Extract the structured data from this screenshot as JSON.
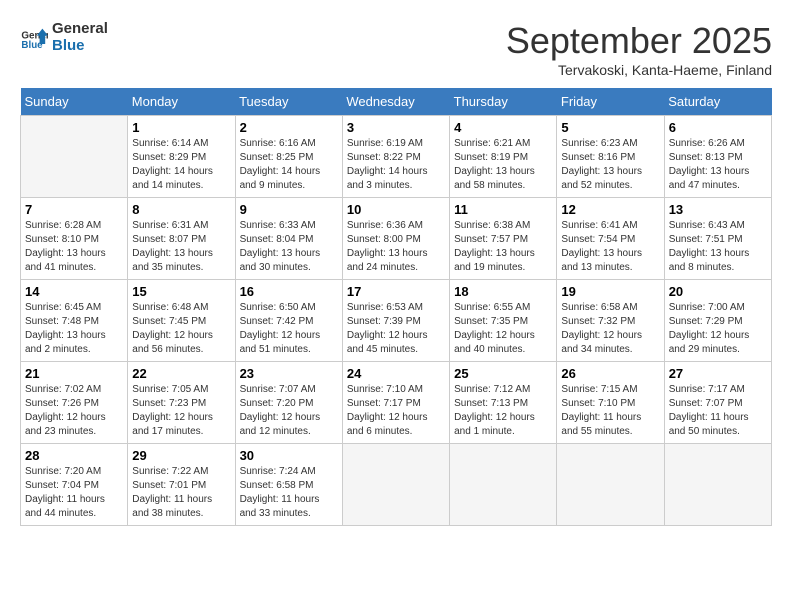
{
  "logo": {
    "line1": "General",
    "line2": "Blue"
  },
  "title": "September 2025",
  "location": "Tervakoski, Kanta-Haeme, Finland",
  "days_of_week": [
    "Sunday",
    "Monday",
    "Tuesday",
    "Wednesday",
    "Thursday",
    "Friday",
    "Saturday"
  ],
  "weeks": [
    [
      {
        "day": "",
        "info": ""
      },
      {
        "day": "1",
        "info": "Sunrise: 6:14 AM\nSunset: 8:29 PM\nDaylight: 14 hours\nand 14 minutes."
      },
      {
        "day": "2",
        "info": "Sunrise: 6:16 AM\nSunset: 8:25 PM\nDaylight: 14 hours\nand 9 minutes."
      },
      {
        "day": "3",
        "info": "Sunrise: 6:19 AM\nSunset: 8:22 PM\nDaylight: 14 hours\nand 3 minutes."
      },
      {
        "day": "4",
        "info": "Sunrise: 6:21 AM\nSunset: 8:19 PM\nDaylight: 13 hours\nand 58 minutes."
      },
      {
        "day": "5",
        "info": "Sunrise: 6:23 AM\nSunset: 8:16 PM\nDaylight: 13 hours\nand 52 minutes."
      },
      {
        "day": "6",
        "info": "Sunrise: 6:26 AM\nSunset: 8:13 PM\nDaylight: 13 hours\nand 47 minutes."
      }
    ],
    [
      {
        "day": "7",
        "info": "Sunrise: 6:28 AM\nSunset: 8:10 PM\nDaylight: 13 hours\nand 41 minutes."
      },
      {
        "day": "8",
        "info": "Sunrise: 6:31 AM\nSunset: 8:07 PM\nDaylight: 13 hours\nand 35 minutes."
      },
      {
        "day": "9",
        "info": "Sunrise: 6:33 AM\nSunset: 8:04 PM\nDaylight: 13 hours\nand 30 minutes."
      },
      {
        "day": "10",
        "info": "Sunrise: 6:36 AM\nSunset: 8:00 PM\nDaylight: 13 hours\nand 24 minutes."
      },
      {
        "day": "11",
        "info": "Sunrise: 6:38 AM\nSunset: 7:57 PM\nDaylight: 13 hours\nand 19 minutes."
      },
      {
        "day": "12",
        "info": "Sunrise: 6:41 AM\nSunset: 7:54 PM\nDaylight: 13 hours\nand 13 minutes."
      },
      {
        "day": "13",
        "info": "Sunrise: 6:43 AM\nSunset: 7:51 PM\nDaylight: 13 hours\nand 8 minutes."
      }
    ],
    [
      {
        "day": "14",
        "info": "Sunrise: 6:45 AM\nSunset: 7:48 PM\nDaylight: 13 hours\nand 2 minutes."
      },
      {
        "day": "15",
        "info": "Sunrise: 6:48 AM\nSunset: 7:45 PM\nDaylight: 12 hours\nand 56 minutes."
      },
      {
        "day": "16",
        "info": "Sunrise: 6:50 AM\nSunset: 7:42 PM\nDaylight: 12 hours\nand 51 minutes."
      },
      {
        "day": "17",
        "info": "Sunrise: 6:53 AM\nSunset: 7:39 PM\nDaylight: 12 hours\nand 45 minutes."
      },
      {
        "day": "18",
        "info": "Sunrise: 6:55 AM\nSunset: 7:35 PM\nDaylight: 12 hours\nand 40 minutes."
      },
      {
        "day": "19",
        "info": "Sunrise: 6:58 AM\nSunset: 7:32 PM\nDaylight: 12 hours\nand 34 minutes."
      },
      {
        "day": "20",
        "info": "Sunrise: 7:00 AM\nSunset: 7:29 PM\nDaylight: 12 hours\nand 29 minutes."
      }
    ],
    [
      {
        "day": "21",
        "info": "Sunrise: 7:02 AM\nSunset: 7:26 PM\nDaylight: 12 hours\nand 23 minutes."
      },
      {
        "day": "22",
        "info": "Sunrise: 7:05 AM\nSunset: 7:23 PM\nDaylight: 12 hours\nand 17 minutes."
      },
      {
        "day": "23",
        "info": "Sunrise: 7:07 AM\nSunset: 7:20 PM\nDaylight: 12 hours\nand 12 minutes."
      },
      {
        "day": "24",
        "info": "Sunrise: 7:10 AM\nSunset: 7:17 PM\nDaylight: 12 hours\nand 6 minutes."
      },
      {
        "day": "25",
        "info": "Sunrise: 7:12 AM\nSunset: 7:13 PM\nDaylight: 12 hours\nand 1 minute."
      },
      {
        "day": "26",
        "info": "Sunrise: 7:15 AM\nSunset: 7:10 PM\nDaylight: 11 hours\nand 55 minutes."
      },
      {
        "day": "27",
        "info": "Sunrise: 7:17 AM\nSunset: 7:07 PM\nDaylight: 11 hours\nand 50 minutes."
      }
    ],
    [
      {
        "day": "28",
        "info": "Sunrise: 7:20 AM\nSunset: 7:04 PM\nDaylight: 11 hours\nand 44 minutes."
      },
      {
        "day": "29",
        "info": "Sunrise: 7:22 AM\nSunset: 7:01 PM\nDaylight: 11 hours\nand 38 minutes."
      },
      {
        "day": "30",
        "info": "Sunrise: 7:24 AM\nSunset: 6:58 PM\nDaylight: 11 hours\nand 33 minutes."
      },
      {
        "day": "",
        "info": ""
      },
      {
        "day": "",
        "info": ""
      },
      {
        "day": "",
        "info": ""
      },
      {
        "day": "",
        "info": ""
      }
    ]
  ]
}
